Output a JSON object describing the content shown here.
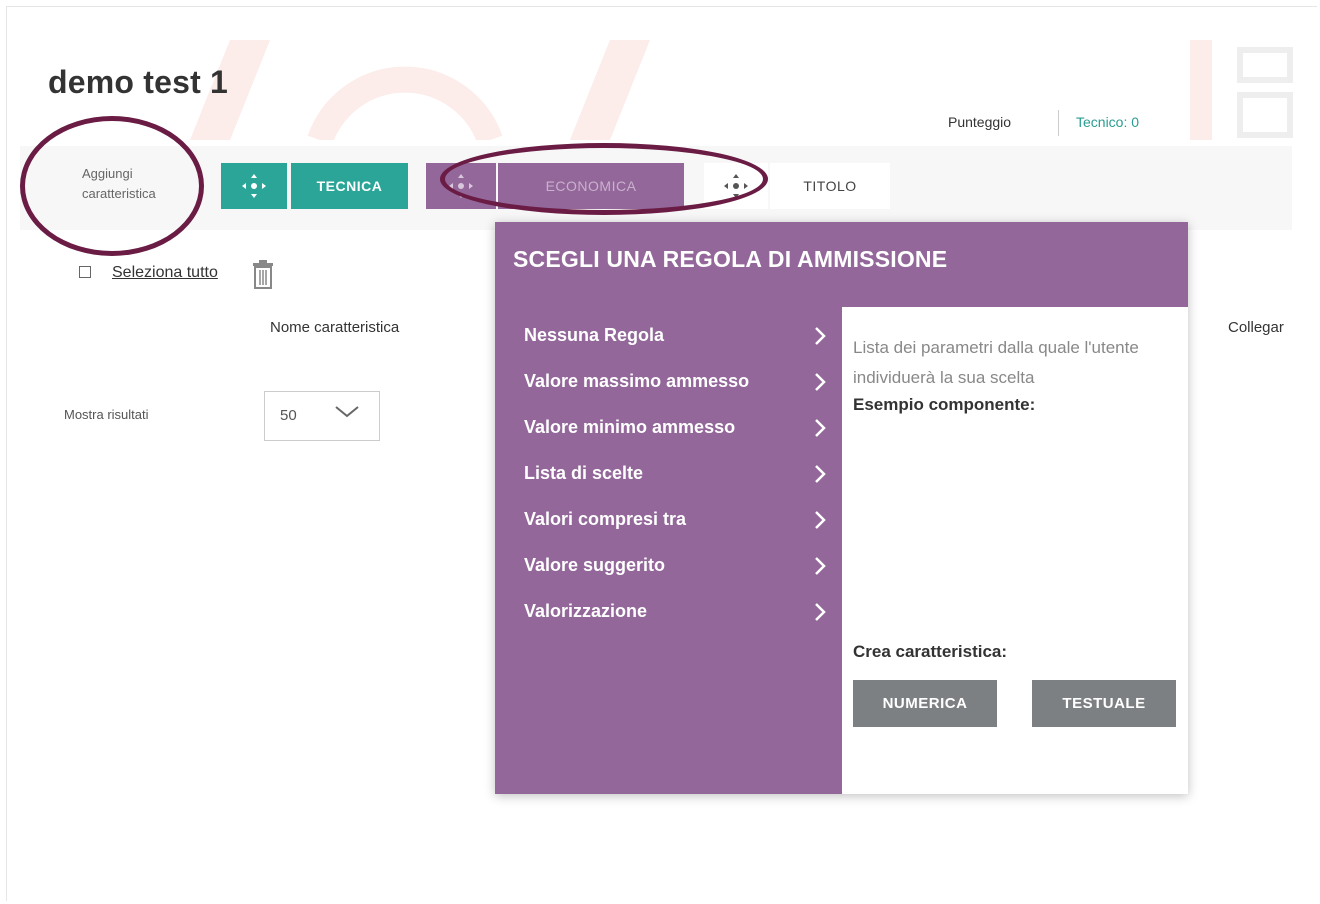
{
  "page": {
    "title": "demo test 1"
  },
  "score": {
    "label": "Punteggio",
    "technical": "Tecnico: 0"
  },
  "toolbar": {
    "add_feature": "Aggiungi caratteristica",
    "tabs": [
      {
        "label": "TECNICA",
        "color": "#2aa597"
      },
      {
        "label": "ECONOMICA",
        "color": "#93679a"
      },
      {
        "label": "TITOLO",
        "color": "#ffffff"
      }
    ]
  },
  "list": {
    "select_all": "Seleziona tutto",
    "columns": {
      "name": "Nome caratteristica",
      "link": "Collegar"
    },
    "show_results_label": "Mostra risultati",
    "show_results_value": "50"
  },
  "modal": {
    "title": "SCEGLI UNA REGOLA DI AMMISSIONE",
    "menu": [
      "Nessuna Regola",
      "Valore massimo ammesso",
      "Valore minimo ammesso",
      "Lista di scelte",
      "Valori compresi tra",
      "Valore suggerito",
      "Valorizzazione"
    ],
    "description": "Lista dei parametri dalla quale l'utente individuerà la sua scelta",
    "example_label": "Esempio componente:",
    "create_label": "Crea caratteristica:",
    "buttons": {
      "numeric": "NUMERICA",
      "text": "TESTUALE"
    }
  },
  "colors": {
    "teal": "#2aa597",
    "purple": "#93679a",
    "annotation": "#6a1c44",
    "gray_button": "#7d8083"
  }
}
